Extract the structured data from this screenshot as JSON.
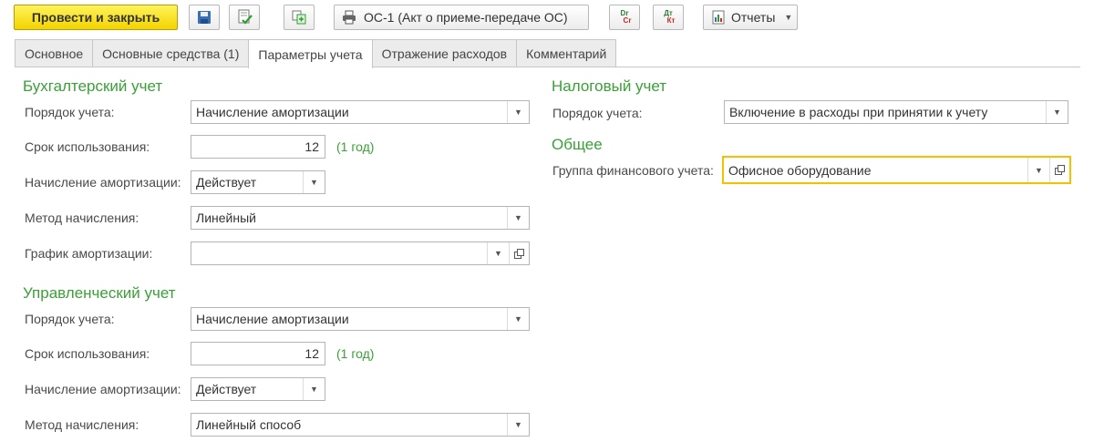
{
  "toolbar": {
    "post_close_label": "Провести и закрыть",
    "print_label": "ОС-1 (Акт о приеме-передаче ОС)",
    "dt_label": "Dr",
    "ct_label": "Cr",
    "dt_ru_label": "Дт",
    "ct_ru_label": "Кт",
    "reports_label": "Отчеты"
  },
  "tabs": [
    {
      "label": "Основное"
    },
    {
      "label": "Основные средства (1)"
    },
    {
      "label": "Параметры учета"
    },
    {
      "label": "Отражение расходов"
    },
    {
      "label": "Комментарий"
    }
  ],
  "accounting": {
    "title": "Бухгалтерский учет",
    "order_label": "Порядок учета:",
    "order_value": "Начисление амортизации",
    "term_label": "Срок использования:",
    "term_value": "12",
    "term_hint": "(1 год)",
    "depreciation_label": "Начисление амортизации:",
    "depreciation_value": "Действует",
    "method_label": "Метод начисления:",
    "method_value": "Линейный",
    "schedule_label": "График амортизации:",
    "schedule_value": ""
  },
  "management": {
    "title": "Управленческий учет",
    "order_label": "Порядок учета:",
    "order_value": "Начисление амортизации",
    "term_label": "Срок использования:",
    "term_value": "12",
    "term_hint": "(1 год)",
    "depreciation_label": "Начисление амортизации:",
    "depreciation_value": "Действует",
    "method_label": "Метод начисления:",
    "method_value": "Линейный способ"
  },
  "tax": {
    "title": "Налоговый учет",
    "order_label": "Порядок учета:",
    "order_value": "Включение в расходы при принятии к учету"
  },
  "general": {
    "title": "Общее",
    "group_label": "Группа финансового учета:",
    "group_value": "Офисное оборудование"
  },
  "colors": {
    "accent_green": "#3aa038",
    "primary_yellow": "#f2d400",
    "focus_yellow": "#f2c200"
  }
}
